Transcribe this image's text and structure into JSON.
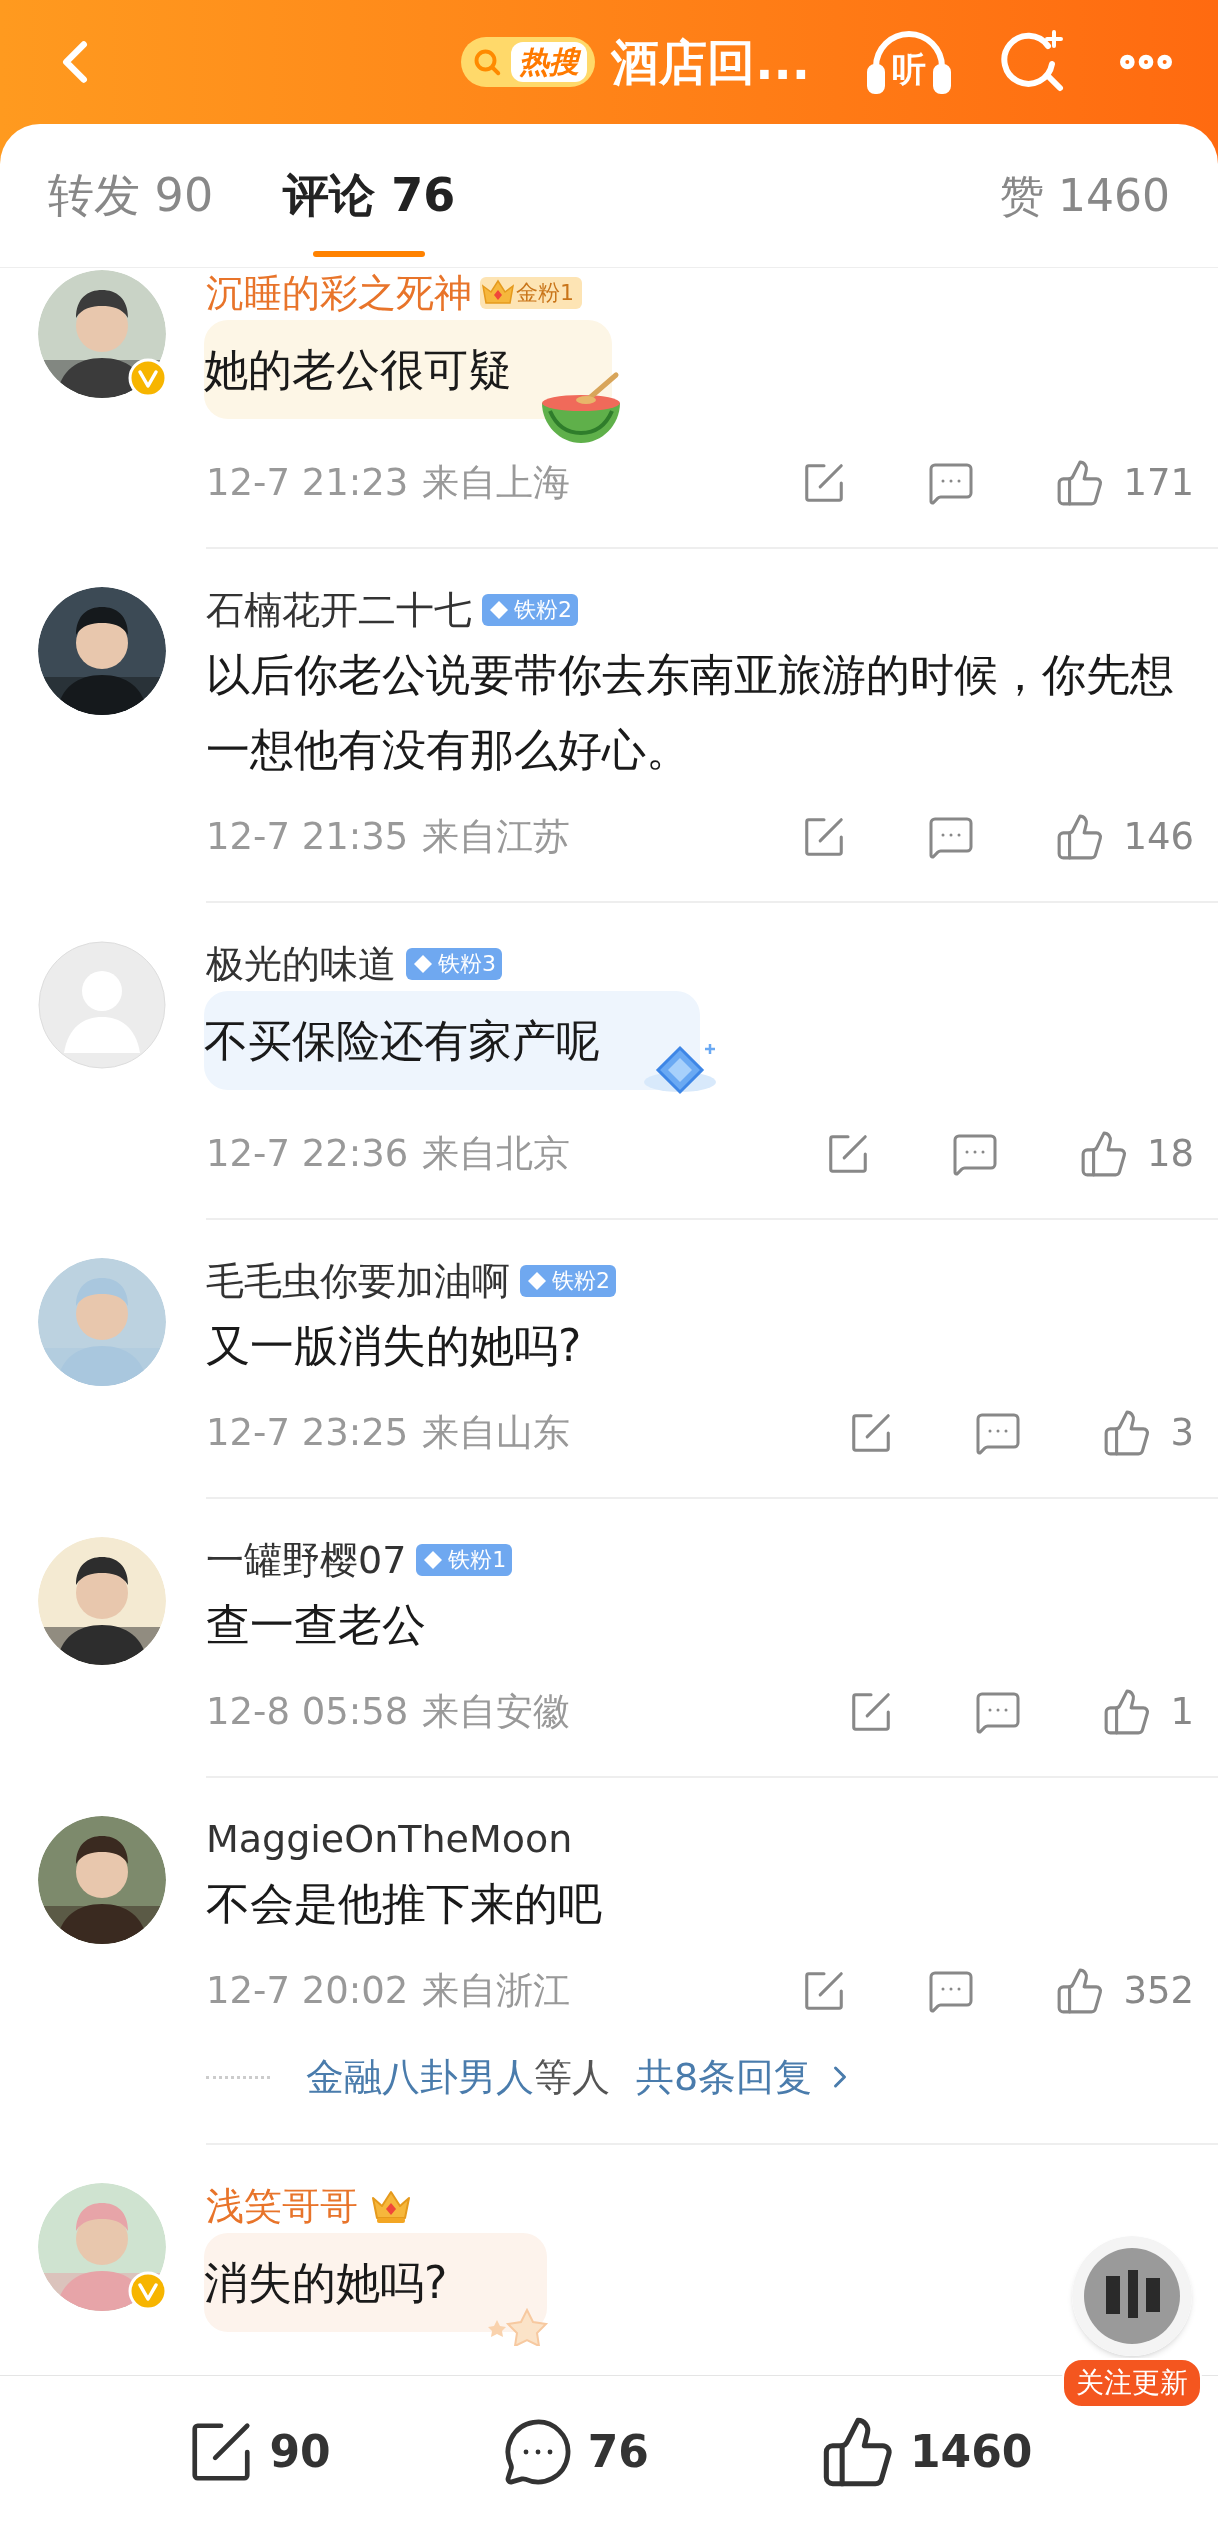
{
  "header": {
    "hot_label": "热搜",
    "title": "酒店回...",
    "listen_label": "听"
  },
  "tabs": [
    {
      "label": "转发 90",
      "selected": false
    },
    {
      "label": "评论 76",
      "selected": true
    }
  ],
  "likes_tab": "赞 1460",
  "comments": [
    {
      "name": "沉睡的彩之死神",
      "vip": true,
      "verified": true,
      "badge": {
        "kind": "gold",
        "label": "金粉1"
      },
      "text": "她的老公很可疑",
      "bubble": {
        "kind": "watermelon"
      },
      "time": "12-7 21:23",
      "location": "来自上海",
      "likes": "171"
    },
    {
      "name": "石楠花开二十七",
      "vip": false,
      "verified": false,
      "badge": {
        "kind": "iron",
        "label": "铁粉2"
      },
      "text": "以后你老公说要带你去东南亚旅游的时候，你先想一想他有没有那么好心。",
      "time": "12-7 21:35",
      "location": "来自江苏",
      "likes": "146"
    },
    {
      "name": "极光的味道",
      "vip": false,
      "avatar": {
        "kind": "default"
      },
      "verified": false,
      "badge": {
        "kind": "iron",
        "label": "铁粉3"
      },
      "text": "不买保险还有家产呢",
      "bubble": {
        "kind": "diamond"
      },
      "time": "12-7 22:36",
      "location": "来自北京",
      "likes": "18"
    },
    {
      "name": "毛毛虫你要加油啊",
      "vip": false,
      "verified": false,
      "badge": {
        "kind": "iron",
        "label": "铁粉2"
      },
      "text": "又一版消失的她吗?",
      "time": "12-7 23:25",
      "location": "来自山东",
      "likes": "3"
    },
    {
      "name": "一罐野樱07",
      "vip": false,
      "verified": false,
      "badge": {
        "kind": "iron",
        "label": "铁粉1"
      },
      "text": "查一查老公",
      "time": "12-8 05:58",
      "location": "来自安徽",
      "likes": "1"
    },
    {
      "name": "MaggieOnTheMoon",
      "vip": false,
      "verified": false,
      "text": "不会是他推下来的吧",
      "time": "12-7 20:02",
      "location": "来自浙江",
      "likes": "352",
      "replies": {
        "names": "金融八卦男人",
        "suffix": "等人",
        "total": "共8条回复"
      }
    },
    {
      "name": "浅笑哥哥",
      "vip": true,
      "verified": true,
      "badge": {
        "kind": "crown"
      },
      "text": "消失的她吗?",
      "bubble": {
        "kind": "stars"
      }
    }
  ],
  "floating": {
    "label": "关注更新"
  },
  "bottom_bar": [
    {
      "kind": "repost",
      "count": "90"
    },
    {
      "kind": "comment",
      "count": "76"
    },
    {
      "kind": "like",
      "count": "1460"
    }
  ]
}
